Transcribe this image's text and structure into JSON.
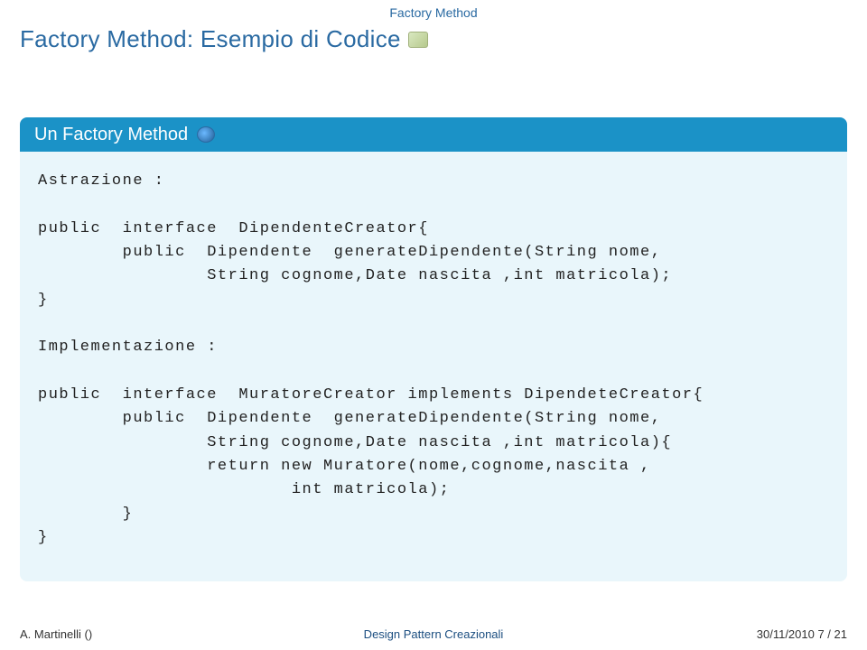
{
  "top_label": "Factory Method",
  "title": "Factory Method: Esempio di Codice",
  "block": {
    "header": "Un Factory Method",
    "code": "Astrazione :\n\npublic  interface  DipendenteCreator{\n        public  Dipendente  generateDipendente(String nome,\n                String cognome,Date nascita ,int matricola);\n}\n\nImplementazione :\n\npublic  interface  MuratoreCreator implements DipendeteCreator{\n        public  Dipendente  generateDipendente(String nome,\n                String cognome,Date nascita ,int matricola){\n                return new Muratore(nome,cognome,nascita ,\n                        int matricola);\n        }\n}"
  },
  "footer": {
    "left": "A. Martinelli ()",
    "center": "Design Pattern Creazionali",
    "right": "30/11/2010    7 / 21"
  }
}
